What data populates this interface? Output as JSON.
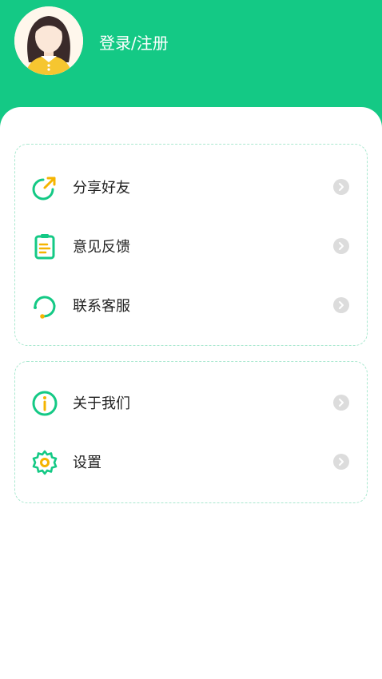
{
  "header": {
    "login_label": "登录/注册",
    "avatar_icon": "girl-avatar-icon",
    "background": "#14c985"
  },
  "menu_group_1": [
    {
      "label": "分享好友",
      "icon": "share-icon"
    },
    {
      "label": "意见反馈",
      "icon": "feedback-icon"
    },
    {
      "label": "联系客服",
      "icon": "customer-service-icon"
    }
  ],
  "menu_group_2": [
    {
      "label": "关于我们",
      "icon": "info-icon"
    },
    {
      "label": "设置",
      "icon": "settings-icon"
    }
  ],
  "colors": {
    "accent": "#14c985",
    "icon_highlight": "#f5b400",
    "border": "#a9e8cf",
    "chevron_bg": "#dcdcdc"
  }
}
